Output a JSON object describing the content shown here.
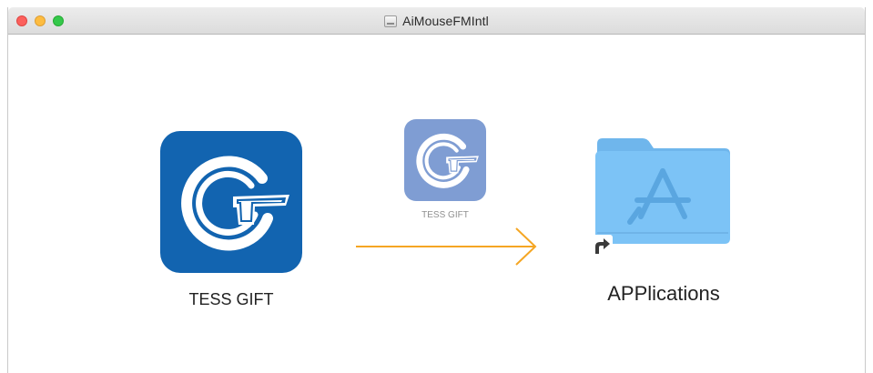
{
  "window": {
    "title": "AiMouseFMIntl"
  },
  "items": {
    "source_app_label": "TESS GIFT",
    "dragging_app_label": "TESS GIFT",
    "destination_label": "APPlications"
  },
  "colors": {
    "app_icon_bg": "#1264b0",
    "dragging_icon_bg": "#7f9dd3",
    "arrow": "#f5a623",
    "folder": "#79c3f5"
  },
  "icons": {
    "source_app": "tess-gift-app-icon",
    "dragging_app": "tess-gift-drag-icon",
    "destination": "applications-folder-icon",
    "alias": "alias-arrow-icon",
    "title": "disk-image-icon"
  }
}
